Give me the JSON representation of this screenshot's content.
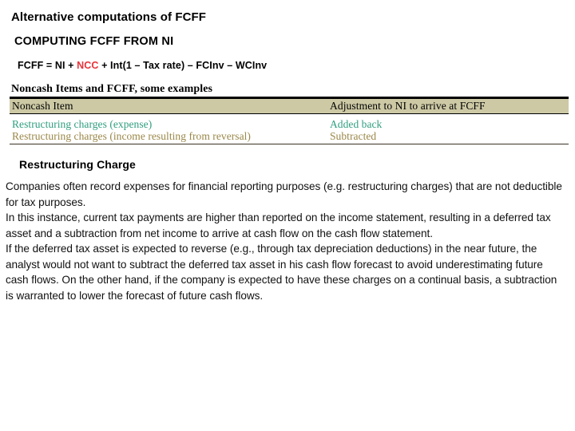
{
  "slide": {
    "title": "Alternative computations of FCFF",
    "subtitle": "COMPUTING FCFF FROM NI",
    "formula": {
      "prefix": "FCFF = NI + ",
      "highlight": "NCC",
      "suffix": " + Int(1 – Tax rate) – FCInv – WCInv",
      "highlight_color": "#e8333a"
    },
    "table": {
      "caption": "Noncash Items and FCFF, some examples",
      "headers": [
        "Noncash Item",
        "Adjustment to NI to arrive at FCFF"
      ],
      "rows": [
        {
          "item": "Restructuring charges (expense)",
          "adjustment": "Added back",
          "color": "#2e9e7e"
        },
        {
          "item": "Restructuring charges (income resulting from reversal)",
          "adjustment": "Subtracted",
          "color": "#9a8748"
        }
      ],
      "header_background": "#cdc9a5"
    },
    "section_heading": "Restructuring Charge",
    "paragraphs": [
      "Companies often record expenses for financial reporting purposes (e.g. restructuring charges) that are not deductible for tax purposes.",
      "In this instance, current tax payments are higher than reported on the income statement, resulting in a deferred tax asset and a subtraction from net income to arrive at cash flow on the cash flow statement.",
      "If the deferred tax asset is expected to reverse (e.g., through tax depreciation deductions) in the near future, the analyst would not want to subtract the deferred tax asset in his cash flow forecast to avoid underestimating future cash flows. On the other hand, if the company is expected to have these charges on a continual basis, a subtraction is warranted to lower the forecast of future cash flows."
    ]
  }
}
